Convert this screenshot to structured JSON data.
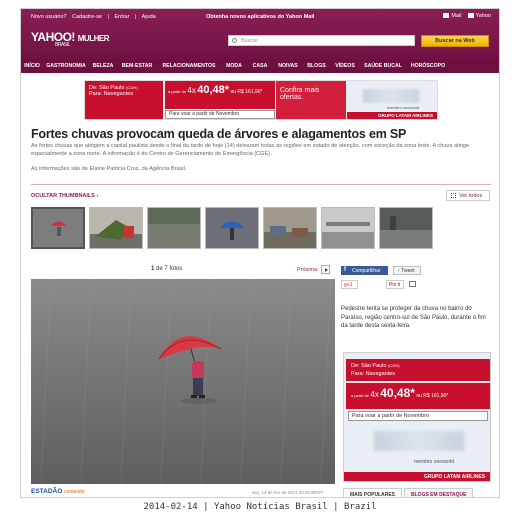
{
  "topbar": {
    "novo": "Novo usuário?",
    "cadastre": "Cadastre-se",
    "sep": "|",
    "entrar": "Entrar",
    "ajuda": "Ajuda",
    "center": "Obtenha novos aplicativos do Yahoo Mail",
    "mail": "Mail",
    "yahoo": "Yahoo"
  },
  "logo": {
    "brand": "YAHOO!",
    "section": "MULHER",
    "country": "BRASIL"
  },
  "search": {
    "placeholder": "Buscar",
    "button": "Buscar na Web"
  },
  "nav": [
    "INÍCIO",
    "GASTRONOMIA",
    "BELEZA",
    "BEM-ESTAR",
    "RELACIONAMENTOS",
    "MODA",
    "CASA",
    "NOIVAS",
    "BLOGS",
    "VÍDEOS",
    "SAÚDE BUCAL",
    "HORÓSCOPO"
  ],
  "ad_top": {
    "de": "De: São Paulo",
    "de_code": "(CGH)",
    "para": "Para: Navegantes",
    "installments": "4x",
    "price": "40,48*",
    "prefix": "a partir de",
    "ou": "ou R$ 161,90*",
    "vote": "Para voar a partir de Novembro",
    "confira": "Confira mais ofertas.",
    "membro": "membro oneworld",
    "grupo": "GRUPO LATAM AIRLINES"
  },
  "article": {
    "title": "Fortes chuvas provocam queda de árvores e alagamentos em SP",
    "intro": "As fortes chuvas que atingem a capital paulista desde o final da tarde de hoje (14) deixaram todas as regiões em estado de atenção, com exceção da zona leste. A chuva atinge especialmente a zona norte. A informação é do Centro de Gerenciamento de Emergência (CGE).",
    "credit": "As informações são de Elaine Patricia Cruz, da Agência Brasil."
  },
  "gallery": {
    "ocultar": "OCULTAR THUMBNAILS",
    "vertodos": "Ver todos",
    "counter_current": "1",
    "counter_rest": "de 7 fotos",
    "proxima": "Próxima",
    "source": "ESTADÃO",
    "source_sub": "conteúdo",
    "date": "sex, 14 de fev de 2014 20:00 BRST",
    "caption": "Pedestre tenta se proteger da chuva no bairro do Paraíso, região centro-sul de São Paulo, durante o fim da tarde desta sexta-feira."
  },
  "social": {
    "facebook": "Compartilhar",
    "twitter": "Tweet",
    "gplus": "+1",
    "pin": "Pin it"
  },
  "ad_side": {
    "de": "De: São Paulo",
    "de_code": "(CGH)",
    "para": "Para: Navegantes",
    "prefix": "a partir de",
    "installments": "4x",
    "price": "40,48*",
    "ou": "ou R$ 161,90*",
    "vote": "Para voar a partir de Novembro",
    "membro": "membro oneworld",
    "grupo": "GRUPO LATAM AIRLINES"
  },
  "tabs": [
    "MAIS POPULARES",
    "BLOGS EM DESTAQUE"
  ],
  "footer": "2014-02-14 | Yahoo Notícias Brasil | Brazil",
  "colors": {
    "brand": "#8a1e55",
    "nav": "#6d1040",
    "ad_red": "#c8102e"
  }
}
